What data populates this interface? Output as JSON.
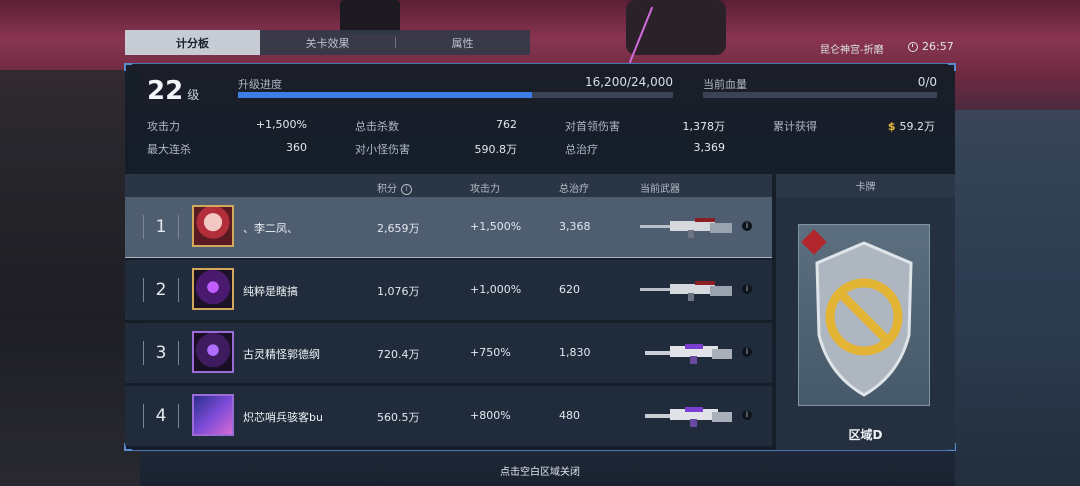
{
  "tabs": [
    {
      "label": "计分板",
      "active": true
    },
    {
      "label": "关卡效果",
      "active": false
    },
    {
      "label": "属性",
      "active": false
    }
  ],
  "location": "昆仑神宫-折磨",
  "time": "26:57",
  "player": {
    "level": "22",
    "level_unit": "级",
    "progress_label": "升级进度",
    "progress_value": "16,200/24,000",
    "progress_fraction": 0.675,
    "hp_label": "当前血量",
    "hp_value": "0/0"
  },
  "stats": [
    {
      "label": "攻击力",
      "value": "+1,500%"
    },
    {
      "label": "总击杀数",
      "value": "762"
    },
    {
      "label": "对首领伤害",
      "value": "1,378万"
    },
    {
      "label": "累计获得",
      "value": "59.2万"
    },
    {
      "label": "最大连杀",
      "value": "360"
    },
    {
      "label": "对小怪伤害",
      "value": "590.8万"
    },
    {
      "label": "总治疗",
      "value": "3,369"
    }
  ],
  "coin_symbol": "$",
  "table": {
    "headers": {
      "score": "积分",
      "atk": "攻击力",
      "heal": "总治疗",
      "weapon": "当前武器",
      "card": "卡牌"
    },
    "rows": [
      {
        "rank": "1",
        "name": "、李二凤、",
        "score": "2,659万",
        "atk": "+1,500%",
        "heal": "3,368",
        "highlight": true
      },
      {
        "rank": "2",
        "name": "纯粹是瞎搞",
        "score": "1,076万",
        "atk": "+1,000%",
        "heal": "620",
        "highlight": false
      },
      {
        "rank": "3",
        "name": "古灵精怪郭德纲",
        "score": "720.4万",
        "atk": "+750%",
        "heal": "1,830",
        "highlight": false
      },
      {
        "rank": "4",
        "name": "炽芯哨兵骇客bu",
        "score": "560.5万",
        "atk": "+800%",
        "heal": "480",
        "highlight": false
      }
    ]
  },
  "card": {
    "label": "区域D"
  },
  "close_hint": "点击空白区域关闭",
  "colors": {
    "accent": "#3a7ee6",
    "coin": "#e8b93a",
    "panel": "#141d28"
  }
}
